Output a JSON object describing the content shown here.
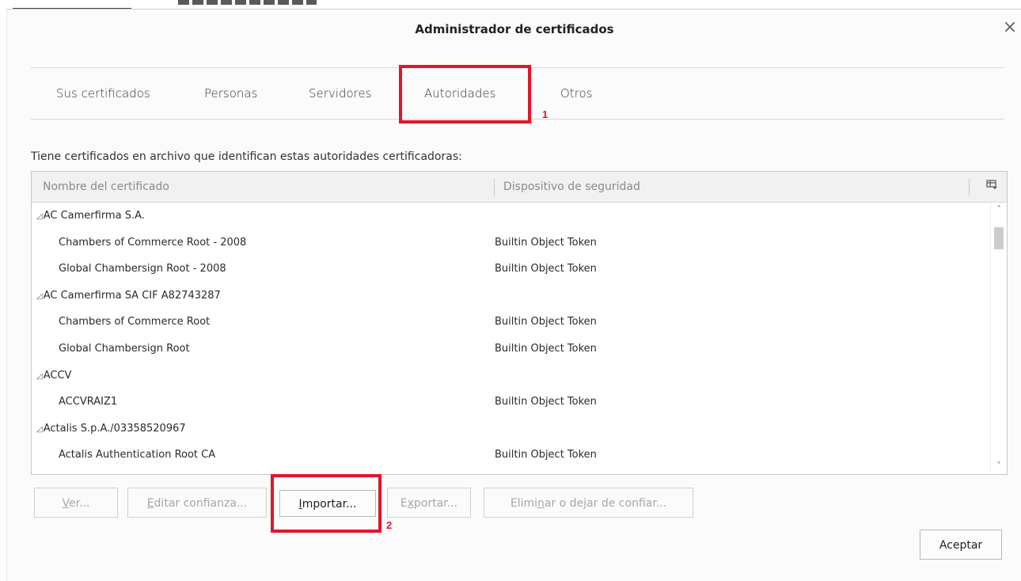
{
  "dialog": {
    "title": "Administrador de certificados",
    "close_glyph": "×"
  },
  "tabs": [
    {
      "label": "Sus certificados",
      "active": false
    },
    {
      "label": "Personas",
      "active": false
    },
    {
      "label": "Servidores",
      "active": false
    },
    {
      "label": "Autoridades",
      "active": true
    },
    {
      "label": "Otros",
      "active": false
    }
  ],
  "annotations": {
    "step1": "1",
    "step2": "2",
    "color": "#e1162b"
  },
  "description": "Tiene certificados en archivo que identifican estas autoridades certificadoras:",
  "table": {
    "columns": [
      "Nombre del certificado",
      "Dispositivo de seguridad"
    ],
    "column_picker_icon": "column-picker-icon",
    "rows": [
      {
        "type": "group",
        "name": "AC Camerfirma S.A.",
        "device": ""
      },
      {
        "type": "cert",
        "name": "Chambers of Commerce Root - 2008",
        "device": "Builtin Object Token"
      },
      {
        "type": "cert",
        "name": "Global Chambersign Root - 2008",
        "device": "Builtin Object Token"
      },
      {
        "type": "group",
        "name": "AC Camerfirma SA CIF A82743287",
        "device": ""
      },
      {
        "type": "cert",
        "name": "Chambers of Commerce Root",
        "device": "Builtin Object Token"
      },
      {
        "type": "cert",
        "name": "Global Chambersign Root",
        "device": "Builtin Object Token"
      },
      {
        "type": "group",
        "name": "ACCV",
        "device": ""
      },
      {
        "type": "cert",
        "name": "ACCVRAIZ1",
        "device": "Builtin Object Token"
      },
      {
        "type": "group",
        "name": "Actalis S.p.A./03358520967",
        "device": ""
      },
      {
        "type": "cert",
        "name": "Actalis Authentication Root CA",
        "device": "Builtin Object Token"
      }
    ]
  },
  "buttons": {
    "view": {
      "pre": "",
      "key": "V",
      "post": "er..."
    },
    "edit_trust": {
      "pre": "",
      "key": "E",
      "post": "ditar confianza..."
    },
    "import": {
      "pre": "",
      "key": "I",
      "post": "mportar..."
    },
    "export": {
      "pre": "E",
      "key": "x",
      "post": "portar..."
    },
    "delete": {
      "pre": "Elimi",
      "key": "n",
      "post": "ar o dejar de confiar..."
    },
    "accept": "Aceptar"
  },
  "colors": {
    "accent_tab": "#ff9500",
    "highlight": "#e1162b"
  }
}
